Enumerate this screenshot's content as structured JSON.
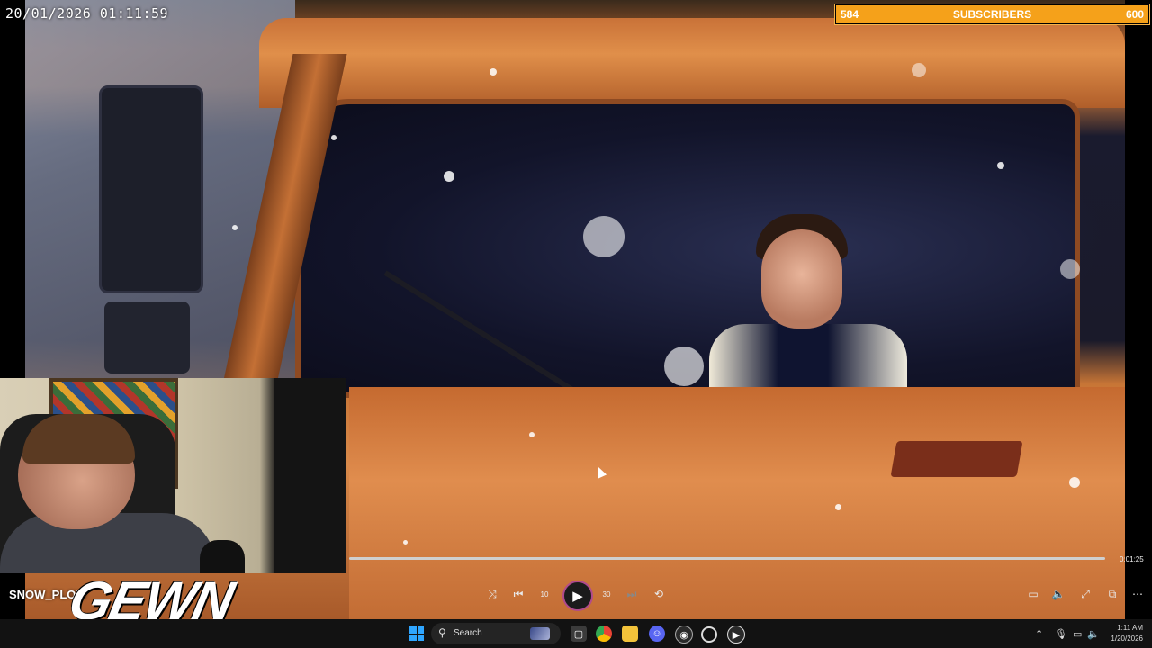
{
  "overlay": {
    "timestamp": "20/01/2026 01:11:59",
    "subscribers": {
      "current": "584",
      "label": "SUBSCRIBERS",
      "goal": "600",
      "progress": 0.973,
      "bar_color": "#f5a11a"
    }
  },
  "player": {
    "total_time": "0:01:25",
    "icons": {
      "shuffle": "shuffle-icon",
      "previous": "previous-track-icon",
      "rewind": "rewind-10-icon",
      "play": "play-icon",
      "forward": "forward-30-icon",
      "next": "next-track-icon",
      "repeat": "repeat-off-icon",
      "miniplayer": "miniplayer-icon",
      "volume": "volume-icon",
      "fullscreen": "fullscreen-icon",
      "cast": "cast-icon",
      "more": "more-icon"
    },
    "glyphs": {
      "shuffle": "⤨",
      "previous": "⏮",
      "rewind": "10",
      "play": "▶",
      "forward": "30",
      "next": "⏭",
      "repeat": "⟲",
      "miniplayer": "▭",
      "volume": "🔈",
      "fullscreen": "⤢",
      "cast": "⧉",
      "more": "⋯"
    }
  },
  "brand": {
    "snow_plow": "SNOW_PLOW",
    "logo_text": "GEWN"
  },
  "taskbar": {
    "search_placeholder": "Search",
    "clock_time": "1:11 AM",
    "clock_date": "1/20/2026",
    "app_icons": [
      "windows-start-icon",
      "task-view-icon",
      "chrome-icon",
      "file-explorer-icon",
      "discord-icon",
      "obs-icon",
      "clock-icon",
      "media-player-icon"
    ],
    "tray_icons": [
      "show-hidden-icons-chevron",
      "microphone-icon",
      "network-icon",
      "speaker-icon"
    ],
    "accent": "#2fa6ff"
  }
}
